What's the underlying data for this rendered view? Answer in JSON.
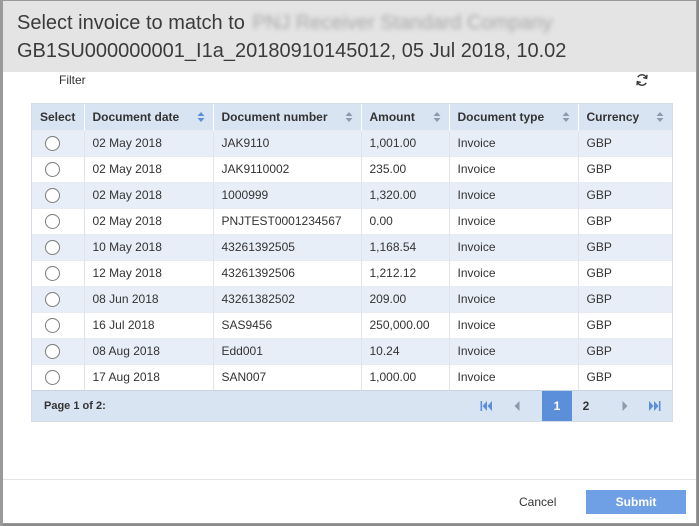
{
  "dialog": {
    "title_prefix": "Select invoice to match to",
    "title_party": "PNJ Receiver Standard Company",
    "title_line2": "GB1SU000000001_I1a_20180910145012, 05 Jul 2018, 10.02"
  },
  "toolbar": {
    "filter_label": "Filter",
    "refresh_icon": "refresh-icon"
  },
  "grid": {
    "columns": [
      "Select",
      "Document date",
      "Document number",
      "Amount",
      "Document type",
      "Currency"
    ],
    "rows": [
      {
        "date": "02 May 2018",
        "number": "JAK9110",
        "amount": "1,001.00",
        "type": "Invoice",
        "currency": "GBP"
      },
      {
        "date": "02 May 2018",
        "number": "JAK9110002",
        "amount": "235.00",
        "type": "Invoice",
        "currency": "GBP"
      },
      {
        "date": "02 May 2018",
        "number": "1000999",
        "amount": "1,320.00",
        "type": "Invoice",
        "currency": "GBP"
      },
      {
        "date": "02 May 2018",
        "number": "PNJTEST0001234567",
        "amount": "0.00",
        "type": "Invoice",
        "currency": "GBP"
      },
      {
        "date": "10 May 2018",
        "number": "43261392505",
        "amount": "1,168.54",
        "type": "Invoice",
        "currency": "GBP"
      },
      {
        "date": "12 May 2018",
        "number": "43261392506",
        "amount": "1,212.12",
        "type": "Invoice",
        "currency": "GBP"
      },
      {
        "date": "08 Jun 2018",
        "number": "43261382502",
        "amount": "209.00",
        "type": "Invoice",
        "currency": "GBP"
      },
      {
        "date": "16 Jul 2018",
        "number": "SAS9456",
        "amount": "250,000.00",
        "type": "Invoice",
        "currency": "GBP"
      },
      {
        "date": "08 Aug 2018",
        "number": "Edd001",
        "amount": "10.24",
        "type": "Invoice",
        "currency": "GBP"
      },
      {
        "date": "17 Aug 2018",
        "number": "SAN007",
        "amount": "1,000.00",
        "type": "Invoice",
        "currency": "GBP"
      }
    ]
  },
  "pager": {
    "info": "Page 1 of 2:",
    "pages": [
      "1",
      "2"
    ],
    "current_page": "1"
  },
  "footer": {
    "cancel_label": "Cancel",
    "submit_label": "Submit"
  },
  "colors": {
    "header_bg": "#e4e4e4",
    "grid_header_bg": "#d9e4f3",
    "row_alt_bg": "#e8eef7",
    "accent": "#5b8fd9",
    "submit_bg": "#6fa0e6"
  }
}
